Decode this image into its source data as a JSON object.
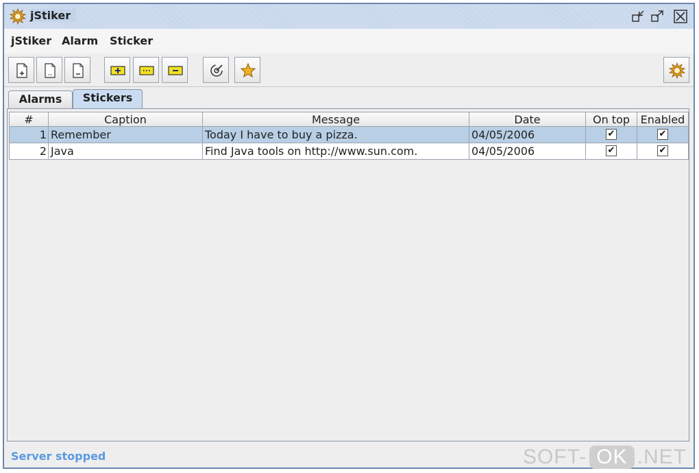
{
  "window": {
    "title": "jStiker",
    "colors": {
      "title_bar": "#c3d4ea",
      "border": "#6e86ae",
      "selection": "#b8cfe5",
      "status": "#5b9ae0"
    }
  },
  "menu": {
    "items": [
      {
        "label": "jStiker"
      },
      {
        "label": "Alarm"
      },
      {
        "label": "Sticker"
      }
    ]
  },
  "toolbar": {
    "buttons": [
      {
        "icon": "new-document-icon"
      },
      {
        "icon": "edit-document-icon"
      },
      {
        "icon": "remove-document-icon"
      },
      {
        "icon": "add-sticker-icon"
      },
      {
        "icon": "edit-sticker-icon"
      },
      {
        "icon": "remove-sticker-icon"
      },
      {
        "icon": "radar-icon"
      },
      {
        "icon": "star-icon"
      },
      {
        "icon": "settings-gear-icon"
      }
    ]
  },
  "tabs": [
    {
      "label": "Alarms",
      "active": false
    },
    {
      "label": "Stickers",
      "active": true
    }
  ],
  "table": {
    "columns": [
      "#",
      "Caption",
      "Message",
      "Date",
      "On top",
      "Enabled"
    ],
    "rows": [
      {
        "num": "1",
        "caption": "Remember",
        "message": "Today I have to buy a pizza.",
        "date": "04/05/2006",
        "on_top": true,
        "enabled": true,
        "selected": true
      },
      {
        "num": "2",
        "caption": "Java",
        "message": "Find Java tools on http://www.sun.com.",
        "date": "04/05/2006",
        "on_top": true,
        "enabled": true,
        "selected": false
      }
    ]
  },
  "status": {
    "text": "Server stopped"
  },
  "watermark": {
    "left": "SOFT-",
    "mid": "OK",
    "right": ".NET"
  }
}
